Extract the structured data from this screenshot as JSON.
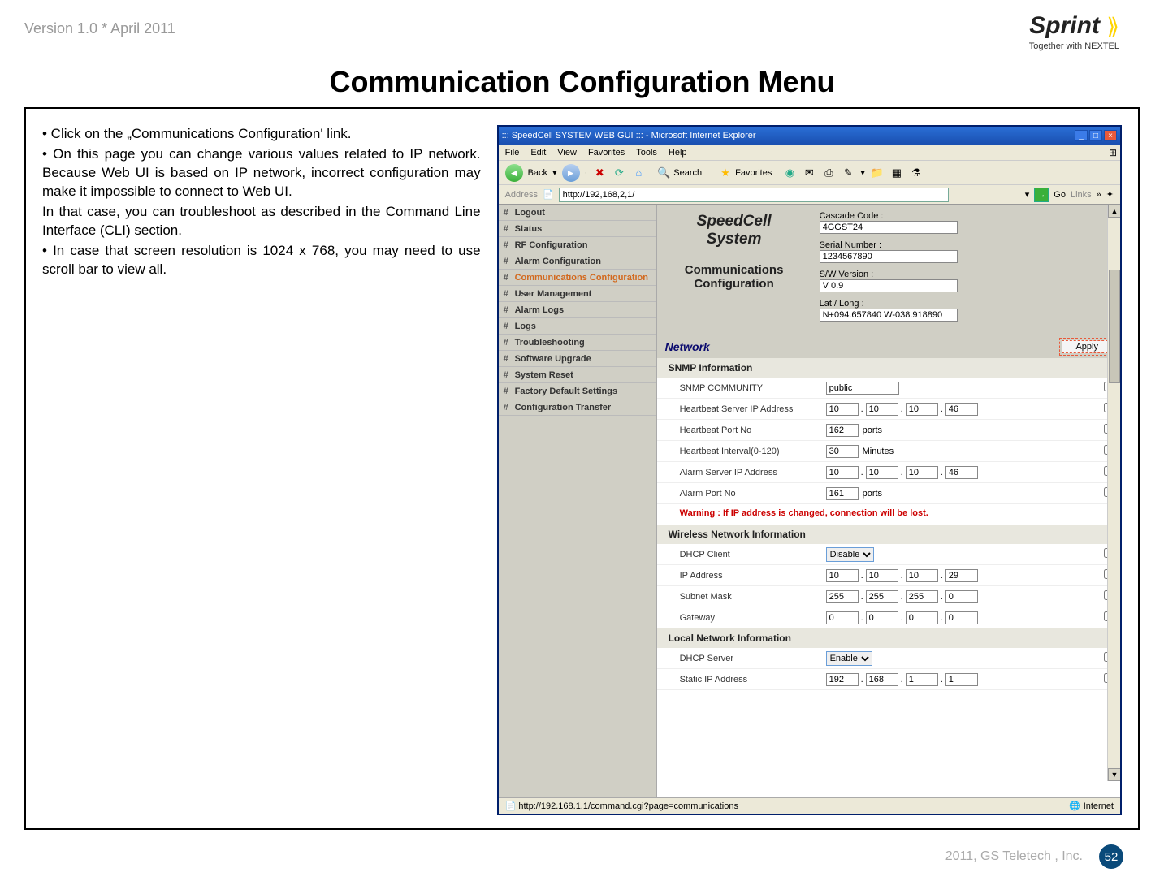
{
  "doc": {
    "version": "Version 1.0 * April 2011",
    "logo_brand": "Sprint",
    "logo_tag": "Together with NEXTEL",
    "title": "Communication Configuration Menu",
    "bullet1": "• Click on the „Communications Configuration' link.",
    "bullet2": "• On this page you can change various values related to IP network. Because Web UI is based on IP network, incorrect configuration may make it impossible to connect to Web UI.",
    "bullet2b": "In that case, you can troubleshoot as described in the Command Line Interface (CLI) section.",
    "bullet3": "• In case that screen resolution is 1024 x 768, you may need to use scroll bar to view all.",
    "footer_text": "2011, GS Teletech , Inc.",
    "page_number": "52"
  },
  "browser": {
    "window_title": "::: SpeedCell SYSTEM WEB GUI ::: - Microsoft Internet Explorer",
    "menu": {
      "file": "File",
      "edit": "Edit",
      "view": "View",
      "favorites": "Favorites",
      "tools": "Tools",
      "help": "Help"
    },
    "toolbar": {
      "back": "Back",
      "search": "Search",
      "favorites": "Favorites"
    },
    "address_label": "Address",
    "address_value": "http://192,168,2,1/",
    "go": "Go",
    "links": "Links",
    "status_left": "http://192.168.1.1/command.cgi?page=communications",
    "status_zone": "Internet"
  },
  "sidebar": {
    "items": [
      {
        "label": "Logout"
      },
      {
        "label": "Status"
      },
      {
        "label": "RF Configuration"
      },
      {
        "label": "Alarm Configuration"
      },
      {
        "label": "Communications Configuration",
        "active": true
      },
      {
        "label": "User Management"
      },
      {
        "label": "Alarm Logs"
      },
      {
        "label": "Logs"
      },
      {
        "label": "Troubleshooting"
      },
      {
        "label": "Software Upgrade"
      },
      {
        "label": "System Reset"
      },
      {
        "label": "Factory Default Settings"
      },
      {
        "label": "Configuration Transfer"
      }
    ]
  },
  "header": {
    "brand_line1": "SpeedCell",
    "brand_line2": "System",
    "page_line1": "Communications",
    "page_line2": "Configuration",
    "cascade_label": "Cascade Code :",
    "cascade_value": "4GGST24",
    "serial_label": "Serial Number :",
    "serial_value": "1234567890",
    "sw_label": "S/W Version :",
    "sw_value": "V 0.9",
    "latlng_label": "Lat / Long :",
    "latlng_value": "N+094.657840 W-038.918890"
  },
  "network": {
    "band_label": "Network",
    "apply": "Apply",
    "snmp_head": "SNMP Information",
    "snmp_community_label": "SNMP COMMUNITY",
    "snmp_community_value": "public",
    "hb_ip_label": "Heartbeat Server IP Address",
    "hb_ip": [
      "10",
      "10",
      "10",
      "46"
    ],
    "hb_port_label": "Heartbeat Port No",
    "hb_port_value": "162",
    "ports_unit": "ports",
    "hb_int_label": "Heartbeat Interval(0-120)",
    "hb_int_value": "30",
    "minutes_unit": "Minutes",
    "alarm_ip_label": "Alarm Server IP Address",
    "alarm_ip": [
      "10",
      "10",
      "10",
      "46"
    ],
    "alarm_port_label": "Alarm Port No",
    "alarm_port_value": "161",
    "warning": "Warning : If IP address is changed, connection will be lost."
  },
  "wireless": {
    "head": "Wireless Network Information",
    "dhcp_client_label": "DHCP Client",
    "dhcp_client_value": "Disable",
    "ip_label": "IP Address",
    "ip": [
      "10",
      "10",
      "10",
      "29"
    ],
    "subnet_label": "Subnet Mask",
    "subnet": [
      "255",
      "255",
      "255",
      "0"
    ],
    "gateway_label": "Gateway",
    "gateway": [
      "0",
      "0",
      "0",
      "0"
    ]
  },
  "local": {
    "head": "Local Network Information",
    "dhcp_server_label": "DHCP Server",
    "dhcp_server_value": "Enable",
    "static_label": "Static IP Address",
    "static_ip": [
      "192",
      "168",
      "1",
      "1"
    ]
  }
}
